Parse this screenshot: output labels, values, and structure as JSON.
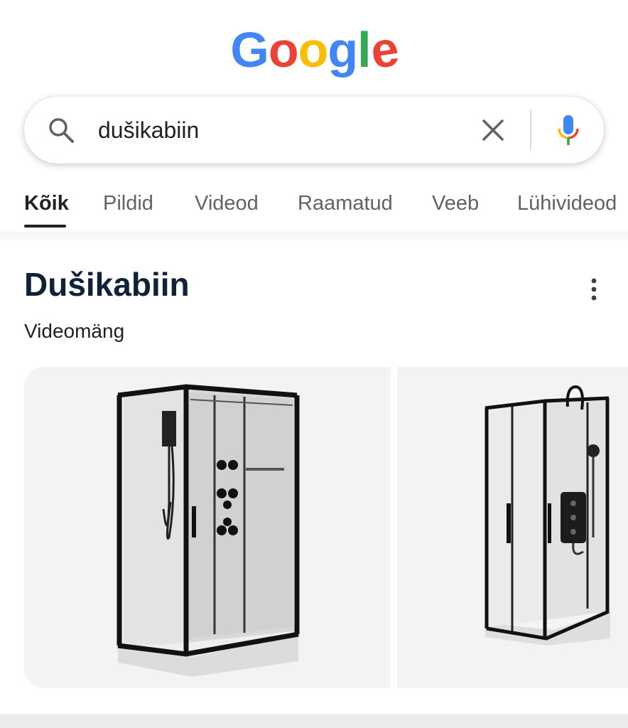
{
  "logo": {
    "letters": [
      "G",
      "o",
      "o",
      "g",
      "l",
      "e"
    ],
    "colors": [
      "#4285F4",
      "#EA4335",
      "#FBBC05",
      "#4285F4",
      "#34A853",
      "#EA4335"
    ]
  },
  "search": {
    "query": "dušikabiin",
    "icons": {
      "left": "search-icon",
      "clear": "close-icon",
      "voice": "microphone-icon"
    }
  },
  "tabs": [
    {
      "label": "Kõik",
      "active": true
    },
    {
      "label": "Pildid",
      "active": false
    },
    {
      "label": "Videod",
      "active": false
    },
    {
      "label": "Raamatud",
      "active": false
    },
    {
      "label": "Veeb",
      "active": false
    },
    {
      "label": "Lühivideod",
      "active": false
    }
  ],
  "knowledge_panel": {
    "title": "Dušikabiin",
    "subtitle": "Videomäng",
    "menu_icon": "more-vert-icon"
  },
  "images": [
    {
      "name": "shower-cabin-image-1"
    },
    {
      "name": "shower-cabin-image-2"
    }
  ],
  "colors": {
    "title": "#112238",
    "tab_active": "#202124",
    "tab_inactive": "#5f6368",
    "card_bg": "#f3f3f3"
  }
}
